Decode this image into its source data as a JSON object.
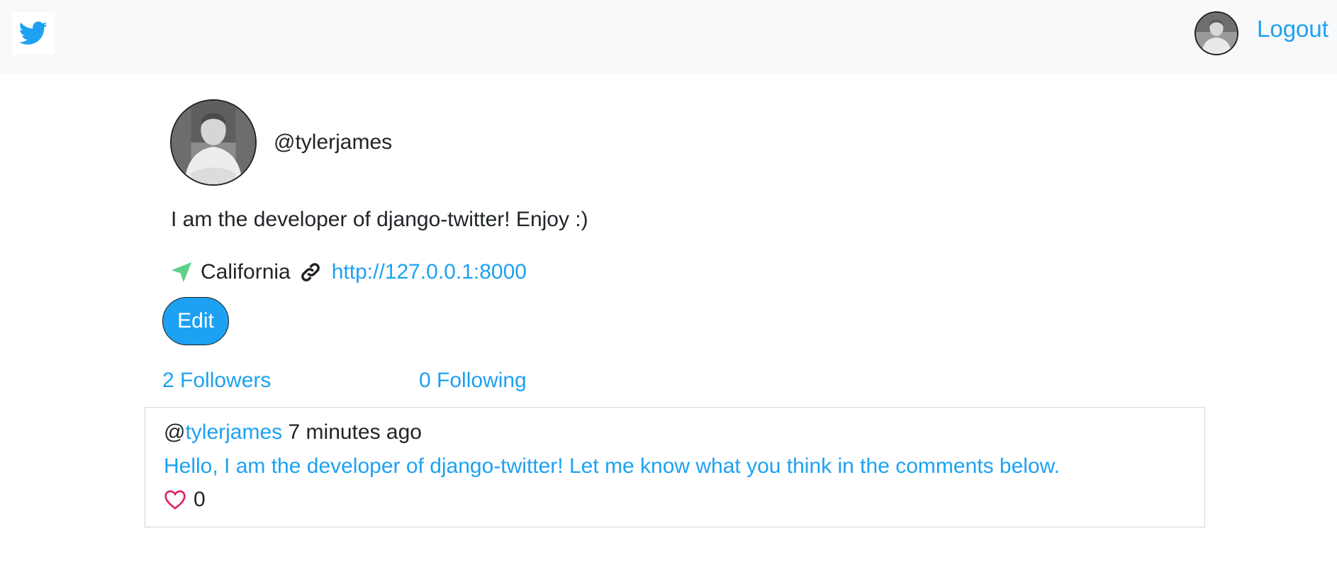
{
  "nav": {
    "brand_icon": "twitter-bird-icon",
    "avatar_icon": "user-avatar",
    "logout_label": "Logout"
  },
  "profile": {
    "handle": "@tylerjames",
    "bio": "I am the developer of django-twitter! Enjoy :)",
    "location": "California",
    "website": "http://127.0.0.1:8000",
    "edit_label": "Edit",
    "followers_label": "2 Followers",
    "following_label": "0 Following"
  },
  "tweet": {
    "at_sign": "@",
    "username": "tylerjames",
    "time": "7 minutes ago",
    "body": "Hello, I am the developer of django-twitter! Let me know what you think in the comments below.",
    "likes": "0"
  },
  "colors": {
    "accent": "#1da1f2",
    "location_icon": "#5fd08a",
    "heart": "#e0245e",
    "navbar_bg": "#f8f9fa"
  }
}
